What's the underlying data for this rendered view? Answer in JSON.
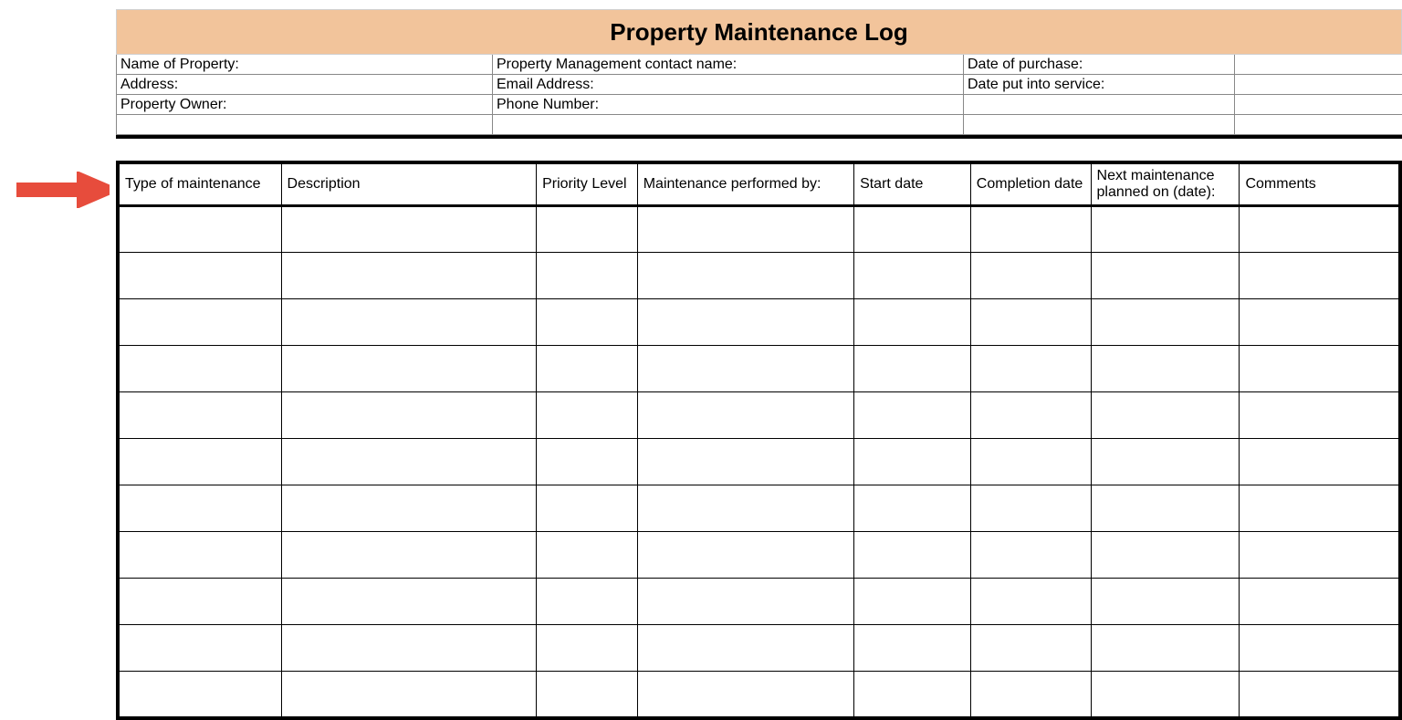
{
  "title": "Property Maintenance Log",
  "info": {
    "row1": {
      "col1": "Name of Property:",
      "col2": "Property Management contact name:",
      "col3": "Date of purchase:",
      "col4": ""
    },
    "row2": {
      "col1": "Address:",
      "col2": "Email Address:",
      "col3": "Date put into service:",
      "col4": ""
    },
    "row3": {
      "col1": "Property Owner:",
      "col2": "Phone Number:",
      "col3": "",
      "col4": ""
    },
    "row4": {
      "col1": "",
      "col2": "",
      "col3": "",
      "col4": ""
    }
  },
  "table_headers": {
    "type": "Type of maintenance",
    "description": "Description",
    "priority": "Priority Level",
    "performed_by": "Maintenance performed by:",
    "start_date": "Start date",
    "completion_date": "Completion date",
    "next_planned": "Next maintenance planned on (date):",
    "comments": "Comments"
  },
  "rows_count": 11
}
